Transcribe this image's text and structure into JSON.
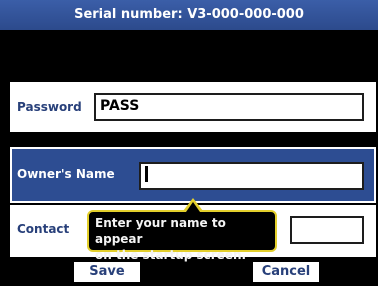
{
  "header": {
    "title": "Serial number: V3-000-000-000"
  },
  "form": {
    "password": {
      "label": "Password",
      "value": "PASS"
    },
    "owner_name": {
      "label": "Owner's Name",
      "value": ""
    },
    "contact": {
      "label": "Contact",
      "value": ""
    }
  },
  "tooltip": {
    "line1": "Enter your name to appear",
    "line2": "on the startup screen."
  },
  "buttons": {
    "save_label": "Save",
    "cancel_label": "Cancel"
  },
  "colors": {
    "title_bar": "#2c4a8c",
    "selected_row": "#2d4d92",
    "label_text": "#28407a",
    "tooltip_border": "#e3cf2c"
  }
}
